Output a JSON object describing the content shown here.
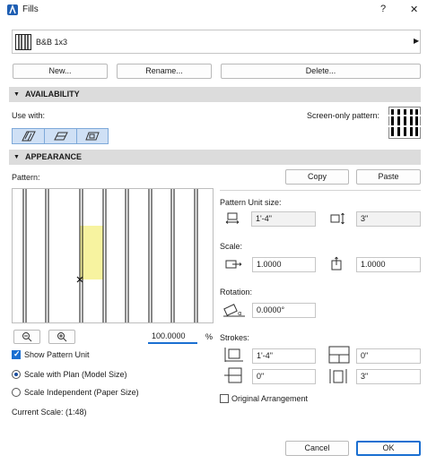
{
  "window": {
    "title": "Fills",
    "help": "?",
    "close": "✕"
  },
  "fill_selector": {
    "name": "B&B 1x3"
  },
  "actions": {
    "new": "New...",
    "rename": "Rename...",
    "delete": "Delete..."
  },
  "availability": {
    "header": "AVAILABILITY",
    "use_with_label": "Use with:",
    "screen_only_label": "Screen-only pattern:"
  },
  "appearance": {
    "header": "APPEARANCE",
    "pattern_label": "Pattern:",
    "copy": "Copy",
    "paste": "Paste",
    "zoom_value": "100.0000",
    "zoom_unit": "%",
    "show_pattern_unit": "Show Pattern Unit",
    "scale_with_plan": "Scale with Plan (Model Size)",
    "scale_independent": "Scale Independent (Paper Size)",
    "current_scale": "Current Scale: (1:48)"
  },
  "pattern_unit": {
    "label": "Pattern Unit size:",
    "width": "1'-4\"",
    "height": "3\""
  },
  "scale": {
    "label": "Scale:",
    "x": "1.0000",
    "y": "1.0000"
  },
  "rotation": {
    "label": "Rotation:",
    "value": "0.0000°"
  },
  "strokes": {
    "label": "Strokes:",
    "a": "1'-4\"",
    "b": "0\"",
    "c": "0\"",
    "d": "3\"",
    "original_arrangement": "Original Arrangement"
  },
  "footer": {
    "cancel": "Cancel",
    "ok": "OK"
  },
  "colors": {
    "accent": "#1a6fd1",
    "section_bg": "#dcdcdc",
    "highlight": "#f7f3a0"
  }
}
